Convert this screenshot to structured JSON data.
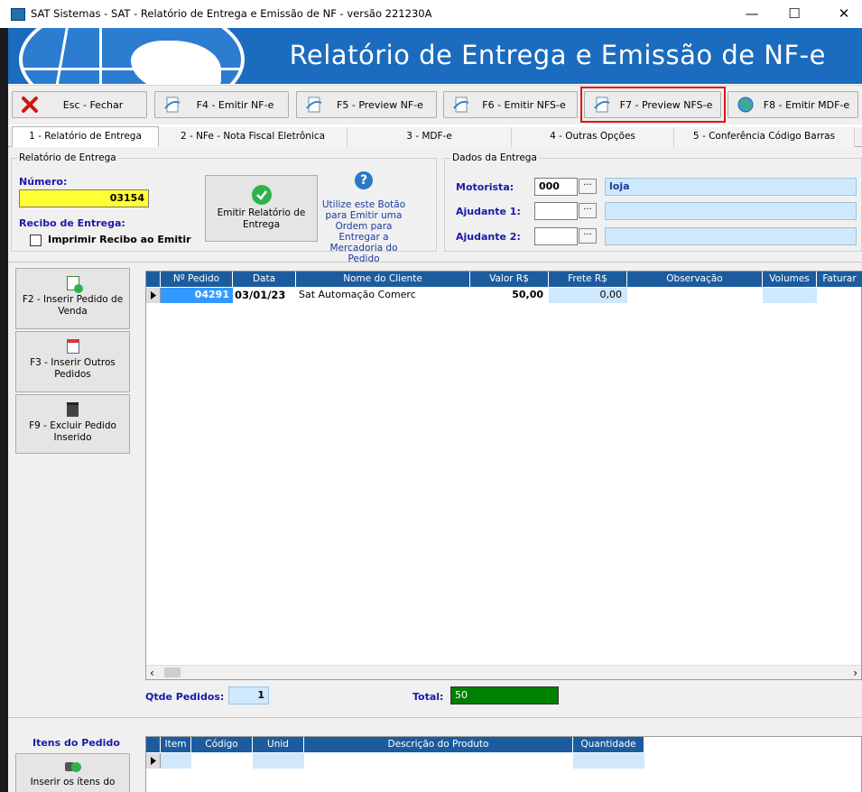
{
  "window": {
    "title": "SAT Sistemas - SAT - Relatório de Entrega e Emissão de NF - versão 221230A",
    "minimize": "—",
    "maximize": "☐",
    "close": "✕"
  },
  "banner": {
    "title": "Relatório de Entrega e Emissão de NF-e"
  },
  "toolbar": {
    "buttons": [
      {
        "label": "Esc - Fechar",
        "icon": "close-x-icon"
      },
      {
        "label": "F4 - Emitir NF-e",
        "icon": "document-icon"
      },
      {
        "label": "F5 - Preview NF-e",
        "icon": "document-icon"
      },
      {
        "label": "F6 - Emitir NFS-e",
        "icon": "document-icon"
      },
      {
        "label": "F7 - Preview NFS-e",
        "icon": "document-icon"
      },
      {
        "label": "F8 - Emitir MDF-e",
        "icon": "globe-icon"
      }
    ],
    "highlighted": "F7 - Preview NFS-e"
  },
  "tabs": [
    "1 - Relatório de Entrega",
    "2 - NFe - Nota Fiscal Eletrônica",
    "3 - MDF-e",
    "4 - Outras Opções",
    "5 - Conferência Código Barras"
  ],
  "relatorio": {
    "legend": "Relatório de Entrega",
    "numero_label": "Número:",
    "numero_value": "03154",
    "recibo_label": "Recibo de Entrega:",
    "imprimir_label": "Imprimir Recibo ao Emitir",
    "emitir_button": "Emitir Relatório de Entrega",
    "help_text": "Utilize este Botão para Emitir uma Ordem para Entregar a Mercadoria do Pedido"
  },
  "dados": {
    "legend": "Dados da Entrega",
    "motorista_label": "Motorista:",
    "motorista_code": "000",
    "motorista_name": "loja",
    "ajudante1_label": "Ajudante 1:",
    "ajudante2_label": "Ajudante 2:",
    "ellipsis": "···"
  },
  "side_buttons": [
    {
      "label": "F2 - Inserir Pedido de Venda",
      "icon": "add-order-icon"
    },
    {
      "label": "F3 - Inserir Outros Pedidos",
      "icon": "insert-other-icon"
    },
    {
      "label": "F9 - Excluir Pedido Inserido",
      "icon": "trash-icon"
    }
  ],
  "pedidos_grid": {
    "columns": [
      "Nº Pedido",
      "Data",
      "Nome do Cliente",
      "Valor R$",
      "Frete R$",
      "Observação",
      "Volumes",
      "Faturar"
    ],
    "rows": [
      {
        "pedido": "04291",
        "data": "03/01/23",
        "cliente": "Sat Automação Comerc",
        "valor": "50,00",
        "frete": "0,00"
      }
    ]
  },
  "totais": {
    "qtde_label": "Qtde Pedidos:",
    "qtde_value": "1",
    "total_label": "Total:",
    "total_value": "50"
  },
  "itens": {
    "title": "Itens do Pedido",
    "insert_button": "Inserir os ítens do",
    "columns": [
      "Item",
      "Código",
      "Unid",
      "Descrição do Produto",
      "Quantidade"
    ]
  },
  "colors": {
    "banner": "#1b6cbf",
    "grid_header": "#1c5c9e",
    "highlight": "#e11414",
    "numero_bg": "#ffff33",
    "total_bg": "#008000",
    "cell_selected": "#3399ff",
    "light_field": "#cfe8fb"
  }
}
